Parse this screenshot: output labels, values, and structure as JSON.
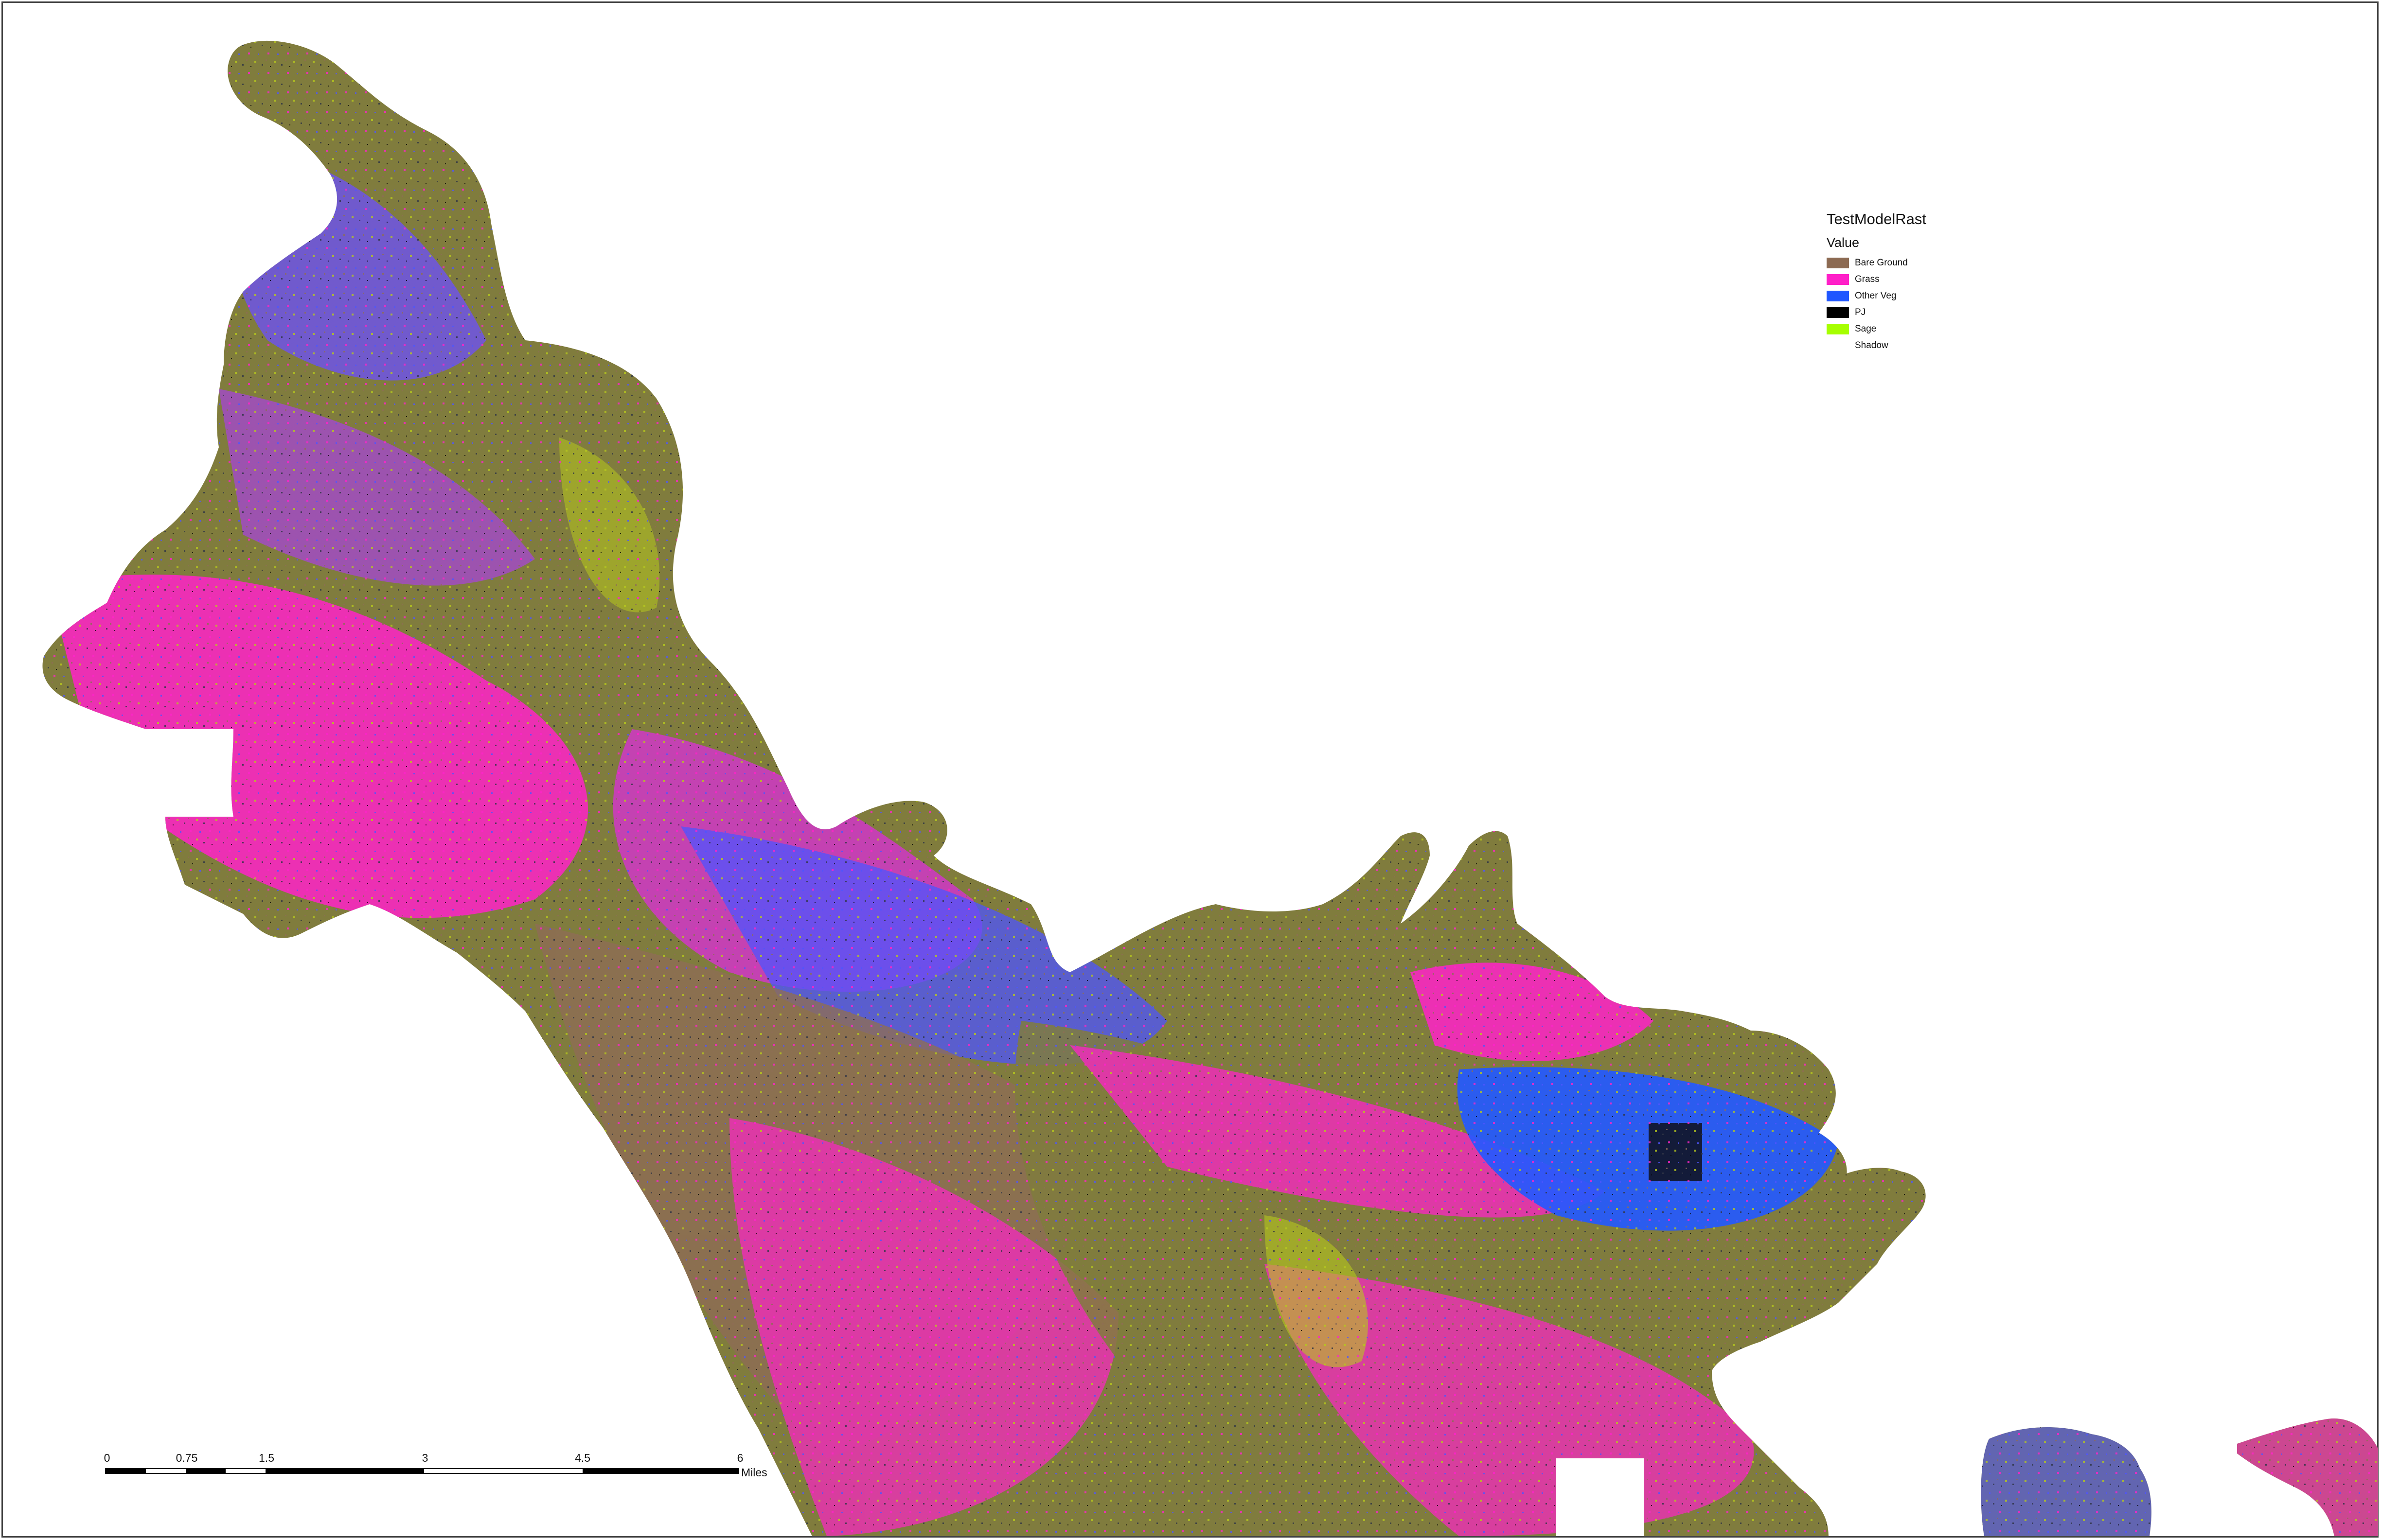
{
  "legend": {
    "title": "TestModelRast",
    "subtitle": "Value",
    "items": [
      {
        "label": "Bare Ground",
        "color": "#8c6a52"
      },
      {
        "label": "Grass",
        "color": "#ff1fc8"
      },
      {
        "label": "Other Veg",
        "color": "#1f56ff"
      },
      {
        "label": "PJ",
        "color": "#000000"
      },
      {
        "label": "Sage",
        "color": "#a6ff00"
      },
      {
        "label": "Shadow",
        "color": "#ffffff"
      }
    ]
  },
  "scale": {
    "labels": [
      "0",
      "0.75",
      "1.5",
      "3",
      "4.5",
      "6"
    ],
    "units": "Miles"
  },
  "map_colors": {
    "olive": "#7e7a3a",
    "magenta": "#ff1fc8",
    "blue": "#4b52ff",
    "brown": "#8c6a52",
    "dark": "#2c3142",
    "yellowgreen": "#b5c71a"
  }
}
